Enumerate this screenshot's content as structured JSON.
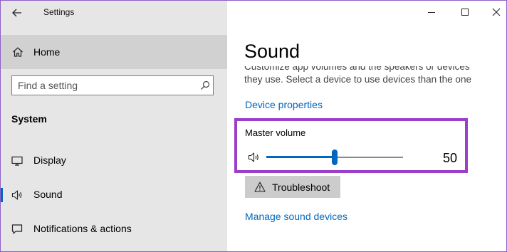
{
  "window": {
    "title": "Settings",
    "controls": [
      "minimize-icon",
      "maximize-icon",
      "close-icon"
    ]
  },
  "sidebar": {
    "home_label": "Home",
    "search_placeholder": "Find a setting",
    "section_header": "System",
    "items": [
      {
        "label": "Display",
        "icon": "display-icon",
        "active": false
      },
      {
        "label": "Sound",
        "icon": "speaker-icon",
        "active": true
      },
      {
        "label": "Notifications & actions",
        "icon": "notifications-icon",
        "active": false
      }
    ]
  },
  "main": {
    "page_title": "Sound",
    "description": "Customize app volumes and the speakers or devices they use. Select a device to use devices than the one selected here. Customize app volumes and devices in advanced sound options.",
    "device_properties_link": "Device properties",
    "master_volume": {
      "label": "Master volume",
      "value": 50,
      "value_text": "50"
    },
    "troubleshoot_label": "Troubleshoot",
    "manage_devices_link": "Manage sound devices"
  },
  "colors": {
    "accent": "#0067c0",
    "highlight_border": "#9b3ec8",
    "sidebar_bg": "#e6e6e6",
    "selected_bg": "#d1d1d1"
  }
}
